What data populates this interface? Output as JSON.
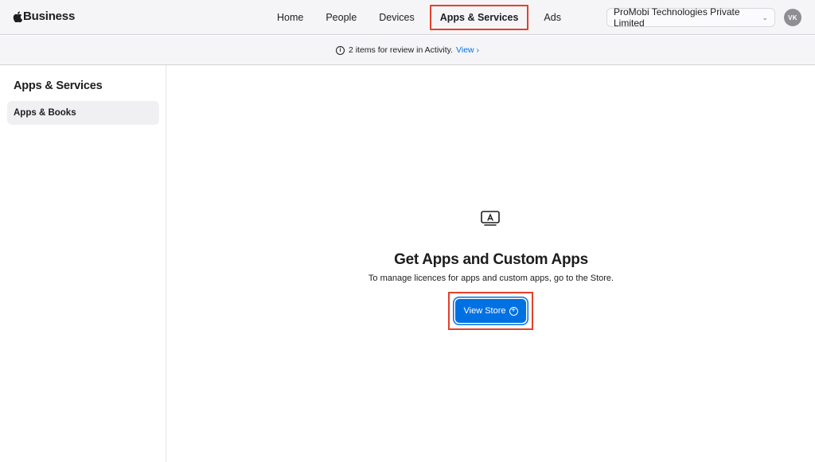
{
  "brand": {
    "name": "Business"
  },
  "nav": {
    "items": [
      {
        "label": "Home",
        "active": false
      },
      {
        "label": "People",
        "active": false
      },
      {
        "label": "Devices",
        "active": false
      },
      {
        "label": "Apps & Services",
        "active": true
      },
      {
        "label": "Ads",
        "active": false
      }
    ]
  },
  "org": {
    "name": "ProMobi Technologies Private Limited"
  },
  "user": {
    "initials": "VK"
  },
  "banner": {
    "message": "2 items for review in Activity.",
    "link": "View"
  },
  "sidebar": {
    "title": "Apps & Services",
    "items": [
      {
        "label": "Apps & Books",
        "selected": true
      }
    ]
  },
  "main": {
    "title": "Get Apps and Custom Apps",
    "subtitle": "To manage licences for apps and custom apps, go to the Store.",
    "button_label": "View Store"
  },
  "colors": {
    "accent": "#0071e3",
    "highlight": "#e4402b",
    "topbar": "#f5f5f7"
  }
}
